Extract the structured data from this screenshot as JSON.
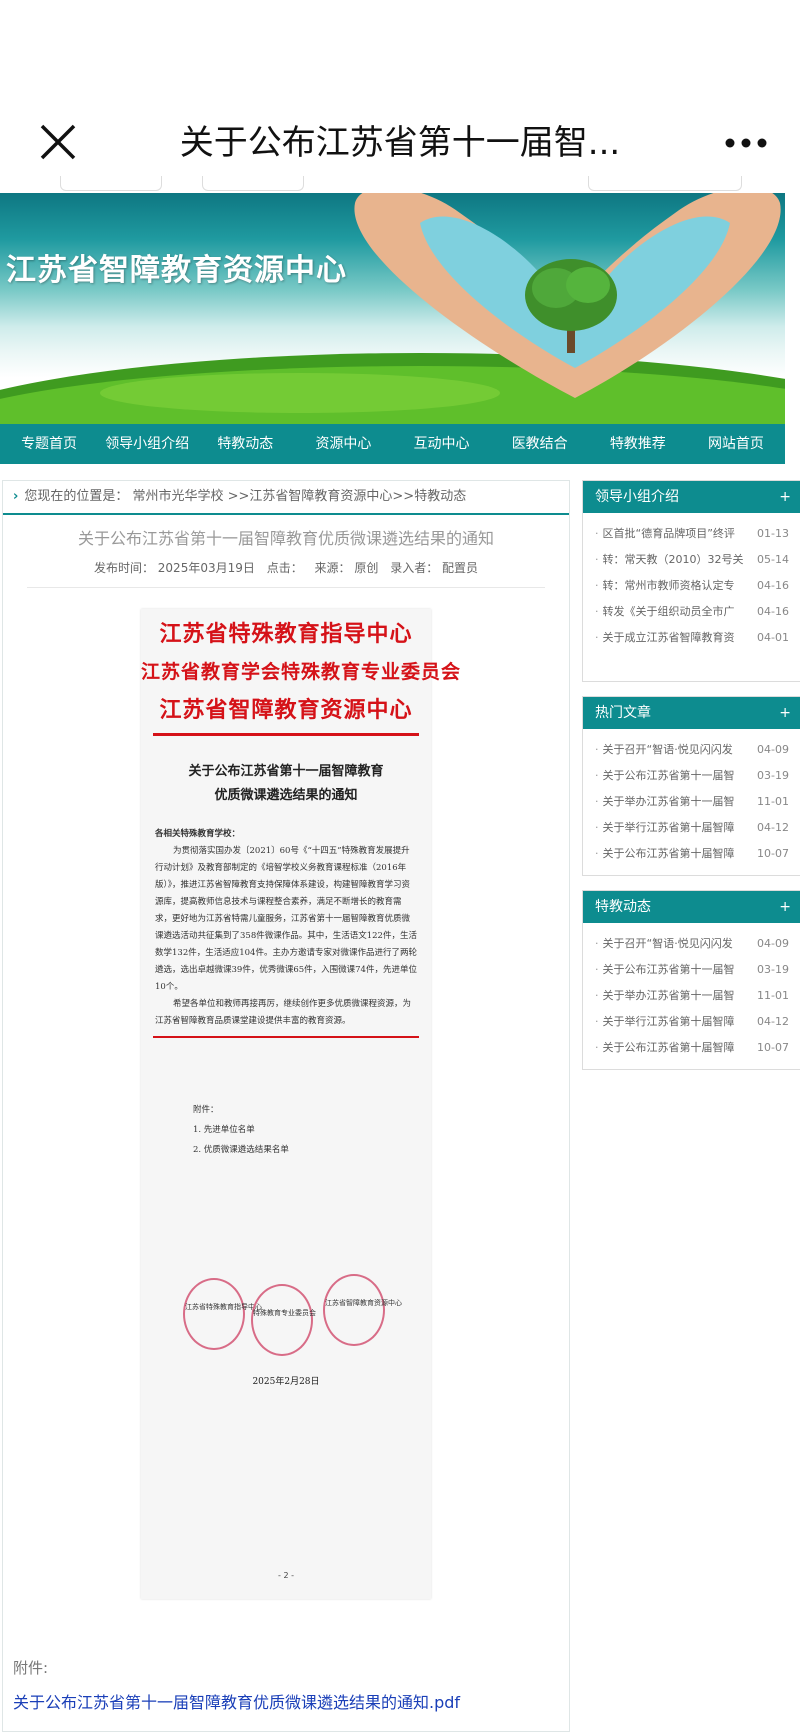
{
  "topbar": {
    "title": "关于公布江苏省第十一届智...",
    "close_icon": "close-icon",
    "more_icon": "more-dots-icon"
  },
  "banner": {
    "site_title": "江苏省智障教育资源中心"
  },
  "nav": [
    "专题首页",
    "领导小组介绍",
    "特教动态",
    "资源中心",
    "互动中心",
    "医教结合",
    "特教推荐",
    "网站首页"
  ],
  "breadcrumb": {
    "text": "您现在的位置是： 常州市光华学校 >>江苏省智障教育资源中心>>特教动态"
  },
  "article": {
    "title": "关于公布江苏省第十一届智障教育优质微课遴选结果的通知",
    "meta": {
      "publish": "发布时间： 2025年03月19日",
      "clicks": "点击：",
      "source": "来源： 原创",
      "editor": "录入者： 配置员"
    }
  },
  "document": {
    "org_lines": [
      "江苏省特殊教育指导中心",
      "江苏省教育学会特殊教育专业委员会",
      "江苏省智障教育资源中心"
    ],
    "title_lines": [
      "关于公布江苏省第十一届智障教育",
      "优质微课遴选结果的通知"
    ],
    "greeting": "各相关特殊教育学校：",
    "para1": "为贯彻落实国办发〔2021〕60号《“十四五”特殊教育发展提升行动计划》及教育部制定的《培智学校义务教育课程标准（2016年版）》，推进江苏省智障教育支持保障体系建设，构建智障教育学习资源库，提高教师信息技术与课程整合素养，满足不断增长的教育需求，更好地为江苏省特需儿童服务，江苏省第十一届智障教育优质微课遴选活动共征集到了358件微课作品。其中，生活语文122件，生活数学132件，生活适应104件。主办方邀请专家对微课作品进行了两轮遴选，选出卓越微课39件，优秀微课65件，入围微课74件，先进单位10个。",
    "para2": "希望各单位和教师再接再厉，继续创作更多优质微课程资源，为江苏省智障教育品质课堂建设提供丰富的教育资源。",
    "attach_title": "附件：",
    "attach_items": [
      "1. 先进单位名单",
      "2. 优质微课遴选结果名单"
    ],
    "seal_labels": [
      "江苏省特殊教育指导中心",
      "特殊教育专业委员会",
      "江苏省智障教育资源中心"
    ],
    "date": "2025年2月28日",
    "page_no": "- 2 -"
  },
  "attachment": {
    "label": "附件:",
    "link": "关于公布江苏省第十一届智障教育优质微课遴选结果的通知.pdf"
  },
  "sidebar": [
    {
      "title": "领导小组介绍",
      "plus": "+",
      "items": [
        {
          "text": "区首批“德育品牌项目”终评",
          "date": "01-13"
        },
        {
          "text": "转：常天教（2010）32号关",
          "date": "05-14"
        },
        {
          "text": "转：常州市教师资格认定专",
          "date": "04-16"
        },
        {
          "text": "转发《关于组织动员全市广",
          "date": "04-16"
        },
        {
          "text": "关于成立江苏省智障教育资",
          "date": "04-01"
        }
      ]
    },
    {
      "title": "热门文章",
      "plus": "+",
      "items": [
        {
          "text": "关于召开“智语·悦见闪闪发",
          "date": "04-09"
        },
        {
          "text": "关于公布江苏省第十一届智",
          "date": "03-19"
        },
        {
          "text": "关于举办江苏省第十一届智",
          "date": "11-01"
        },
        {
          "text": "关于举行江苏省第十届智障",
          "date": "04-12"
        },
        {
          "text": "关于公布江苏省第十届智障",
          "date": "10-07"
        }
      ]
    },
    {
      "title": "特教动态",
      "plus": "+",
      "items": [
        {
          "text": "关于召开“智语·悦见闪闪发",
          "date": "04-09"
        },
        {
          "text": "关于公布江苏省第十一届智",
          "date": "03-19"
        },
        {
          "text": "关于举办江苏省第十一届智",
          "date": "11-01"
        },
        {
          "text": "关于举行江苏省第十届智障",
          "date": "04-12"
        },
        {
          "text": "关于公布江苏省第十届智障",
          "date": "10-07"
        }
      ]
    }
  ]
}
